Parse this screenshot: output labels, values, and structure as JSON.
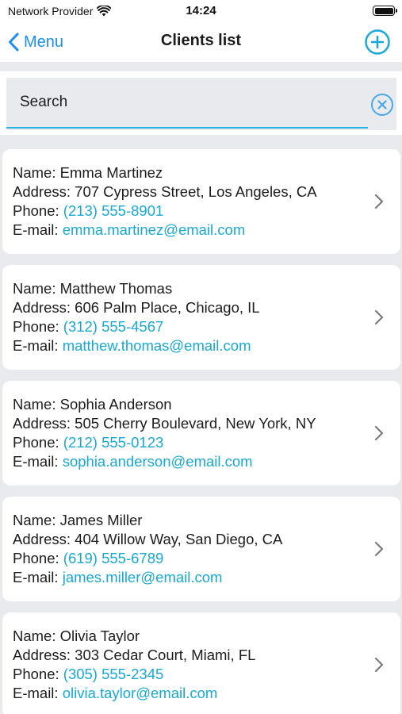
{
  "status_bar": {
    "carrier": "Network Provider",
    "time": "14:24"
  },
  "nav": {
    "back_label": "Menu",
    "title": "Clients list"
  },
  "search": {
    "value": "",
    "placeholder": "Search"
  },
  "labels": {
    "name": "Name:",
    "address": "Address:",
    "phone": "Phone:",
    "email": "E-mail:"
  },
  "clients": [
    {
      "name": "Emma Martinez",
      "address": "707 Cypress Street, Los Angeles, CA",
      "phone": "(213) 555-8901",
      "email": "emma.martinez@email.com"
    },
    {
      "name": "Matthew Thomas",
      "address": "606 Palm Place, Chicago, IL",
      "phone": "(312) 555-4567",
      "email": "matthew.thomas@email.com"
    },
    {
      "name": "Sophia Anderson",
      "address": "505 Cherry Boulevard, New York, NY",
      "phone": "(212) 555-0123",
      "email": "sophia.anderson@email.com"
    },
    {
      "name": "James Miller",
      "address": "404 Willow Way, San Diego, CA",
      "phone": "(619) 555-6789",
      "email": "james.miller@email.com"
    },
    {
      "name": "Olivia Taylor",
      "address": "303 Cedar Court, Miami, FL",
      "phone": "(305) 555-2345",
      "email": "olivia.taylor@email.com"
    }
  ],
  "colors": {
    "accent": "#1a8ef4",
    "link": "#17a9d6",
    "background": "#e9eaee"
  },
  "icons": {
    "back": "chevron-left-icon",
    "add": "plus-circle-icon",
    "clear": "x-circle-icon",
    "row": "chevron-right-icon",
    "wifi": "wifi-icon",
    "battery": "battery-icon"
  }
}
